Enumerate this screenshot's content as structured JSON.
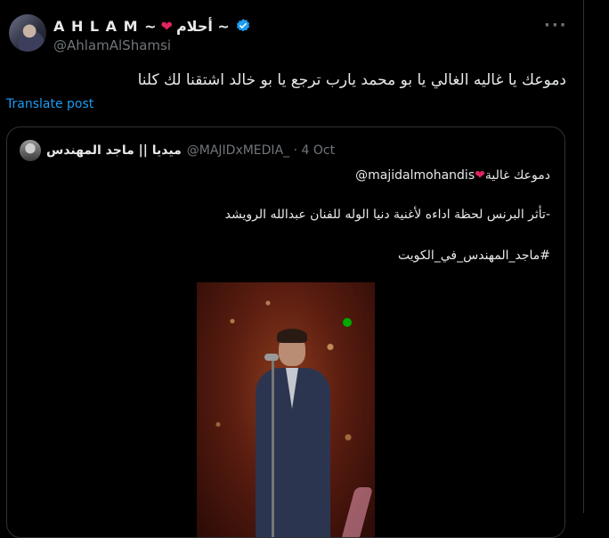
{
  "author": {
    "display_name": "A H L A M ~",
    "display_name_ar": "أحلام ~",
    "handle": "@AhlamAlShamsi",
    "avatar_icon": "profile-photo",
    "verified_icon": "verified-badge-icon"
  },
  "post": {
    "text": "دموعك يا غاليه الغالي  يا بو محمد يارب ترجع يا بو خالد اشتقنا لك كلنا",
    "translate_label": "Translate post",
    "more_icon": "ellipsis-icon"
  },
  "quote": {
    "author_name": "ميديا || ماجد المهندس",
    "handle_date": "@MAJIDxMEDIA_ · 4 Oct",
    "line1_prefix": "دموعك غالية",
    "line1_mention": "@majidalmohandis",
    "line2": "-تأثر البرنس لحظة اداءه لأغنية دنيا الوله للفنان عبدالله الرويشد",
    "line3": "#ماجد_المهندس_في_الكويت",
    "media_icon": "video-thumbnail"
  },
  "colors": {
    "background": "#000000",
    "text": "#e7e9ea",
    "secondary": "#71767b",
    "link": "#1d9bf0",
    "heart": "#e0245e",
    "border": "#2f3336"
  }
}
